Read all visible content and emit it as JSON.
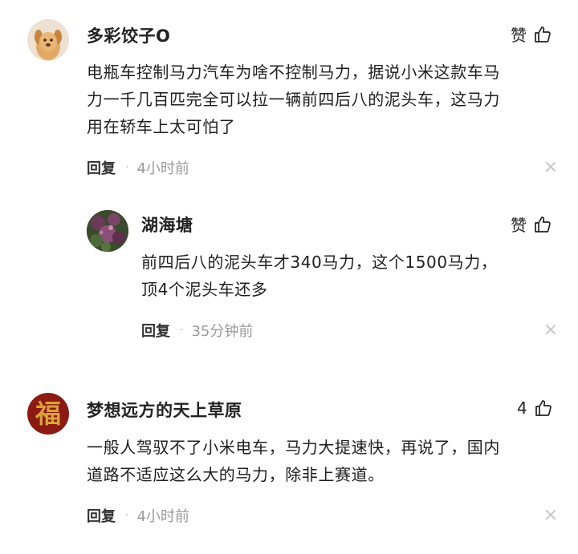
{
  "comments": [
    {
      "username": "多彩饺子O",
      "like_label": "赞",
      "text_lines": [
        "电瓶车控制马力汽车为啥不控制马力，据说小米这款车马",
        "力一千几百匹完全可以拉一辆前四后八的泥头车，这马力",
        "用在轿车上太可怕了"
      ],
      "reply_label": "回复",
      "separator": "·",
      "time": "4小时前",
      "avatar_icon": "cartoon-dog-avatar"
    },
    {
      "username": "湖海塘",
      "like_label": "赞",
      "text_lines": [
        "前四后八的泥头车才340马力，这个1500马力，",
        "顶4个泥头车还多"
      ],
      "reply_label": "回复",
      "separator": "·",
      "time": "35分钟前",
      "avatar_icon": "flower-photo-avatar"
    },
    {
      "username": "梦想远方的天上草原",
      "like_label": "4",
      "text_lines": [
        "一般人驾驭不了小米电车，马力大提速快，再说了，国内",
        "道路不适应这么大的马力，除非上赛道。"
      ],
      "reply_label": "回复",
      "separator": "·",
      "time": "4小时前",
      "avatar_icon": "fu-character-avatar",
      "avatar_char": "福"
    }
  ],
  "colors": {
    "text": "#1e1e1e",
    "muted": "#9a9a9a",
    "avatar_fu_bg": "#8b1a12",
    "avatar_fu_char": "#d9a23a"
  }
}
